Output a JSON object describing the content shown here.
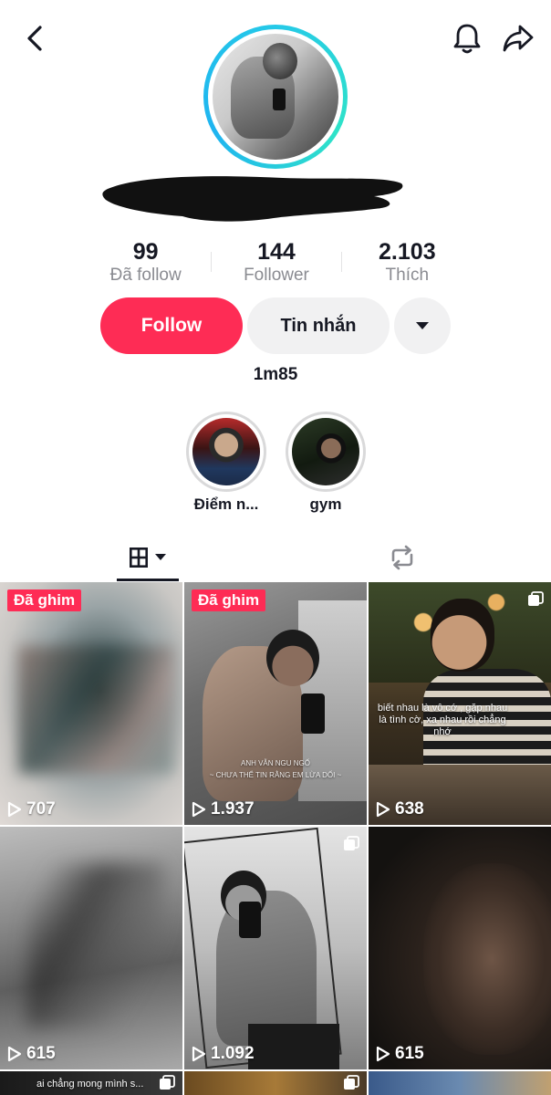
{
  "header": {
    "back_icon": "chevron-left-icon",
    "bell_icon": "bell-icon",
    "share_icon": "share-arrow-icon"
  },
  "profile": {
    "stats": [
      {
        "value": "99",
        "label": "Đã follow"
      },
      {
        "value": "144",
        "label": "Follower"
      },
      {
        "value": "2.103",
        "label": "Thích"
      }
    ],
    "follow_label": "Follow",
    "message_label": "Tin nhắn",
    "bio": "1m85"
  },
  "highlights": [
    {
      "label": "Điểm n..."
    },
    {
      "label": "gym"
    }
  ],
  "tabs": {
    "grid_icon": "grid-icon",
    "repost_icon": "repost-icon"
  },
  "videos": [
    {
      "pinned_label": "Đã ghim",
      "views": "707"
    },
    {
      "pinned_label": "Đã ghim",
      "views": "1.937",
      "caption_line1": "ANH VẪN NGU NGỐ",
      "caption_line2": "~ CHƯA THỂ TIN RẰNG EM LỪA DỐI ~"
    },
    {
      "views": "638",
      "caption": "biết nhau là vô cớ , gặp nhau là tình cờ, xa nhau rồi chẳng nhớ"
    },
    {
      "views": "615"
    },
    {
      "views": "1.092"
    },
    {
      "views": "615"
    },
    {
      "caption": "ai chẳng mong mình s..."
    }
  ],
  "colors": {
    "accent": "#fe2c55",
    "ring": "#25c9e8"
  }
}
